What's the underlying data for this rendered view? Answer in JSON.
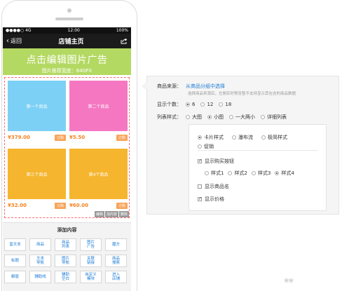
{
  "status_bar": {
    "carrier": "●●●●○ 4G",
    "time": "12:00",
    "battery": "100%"
  },
  "nav": {
    "back_label": "返回",
    "title": "店铺主页",
    "share_icon": "share-icon"
  },
  "banner": {
    "title": "点击编辑图片广告",
    "subtitle": "图片推荐宽度：640PX",
    "color": "#b4d963"
  },
  "products": [
    {
      "name": "第一个商品",
      "price": "¥379.00",
      "buy": "订购",
      "color": "#7dd0f5"
    },
    {
      "name": "第二个商品",
      "price": "¥5.50",
      "buy": "订购",
      "color": "#f577c1"
    },
    {
      "name": "第三个商品",
      "price": "¥32.00",
      "buy": "订购",
      "color": "#f5b52e"
    },
    {
      "name": "第4个商品",
      "price": "¥60.00",
      "buy": "订购",
      "color": "#f5b52e"
    }
  ],
  "edit_tools": [
    "编辑",
    "加内容",
    "删除"
  ],
  "add_panel": {
    "title": "添加内容",
    "buttons": [
      "富文本",
      "商品",
      "商品\n列表",
      "图片\n广告",
      "魔方",
      "标题",
      "文本\n导航",
      "图片\n导航",
      "关联\n链接",
      "商品\n搜索",
      "橱窗",
      "辅助线",
      "辅助\n空白",
      "自定义\n模块",
      "进入\n店铺"
    ]
  },
  "settings": {
    "source_label": "商品来源：",
    "source_link": "从商品分组中选择",
    "source_hint": "选择商品来源后，左侧实时预览暂不支持显示其包含的商品数据",
    "count_label": "显示个数：",
    "count_options": [
      "6",
      "12",
      "18"
    ],
    "count_selected": 0,
    "style_label": "列表样式：",
    "style_options": [
      "大图",
      "小图",
      "一大两小",
      "详细列表"
    ],
    "style_selected": 1,
    "card_options": [
      "卡片样式",
      "瀑布流",
      "极简样式",
      "促销"
    ],
    "card_selected": 0,
    "show_buy_label": "显示购买按钮",
    "show_buy_checked": true,
    "buy_styles": [
      "样式1",
      "样式2",
      "样式3",
      "样式4"
    ],
    "buy_style_selected": 3,
    "show_name_label": "显示商品名",
    "show_name_checked": false,
    "show_price_label": "显示价格",
    "show_price_checked": true
  },
  "accent_color": "#1a7ad4",
  "price_color": "#f58220"
}
